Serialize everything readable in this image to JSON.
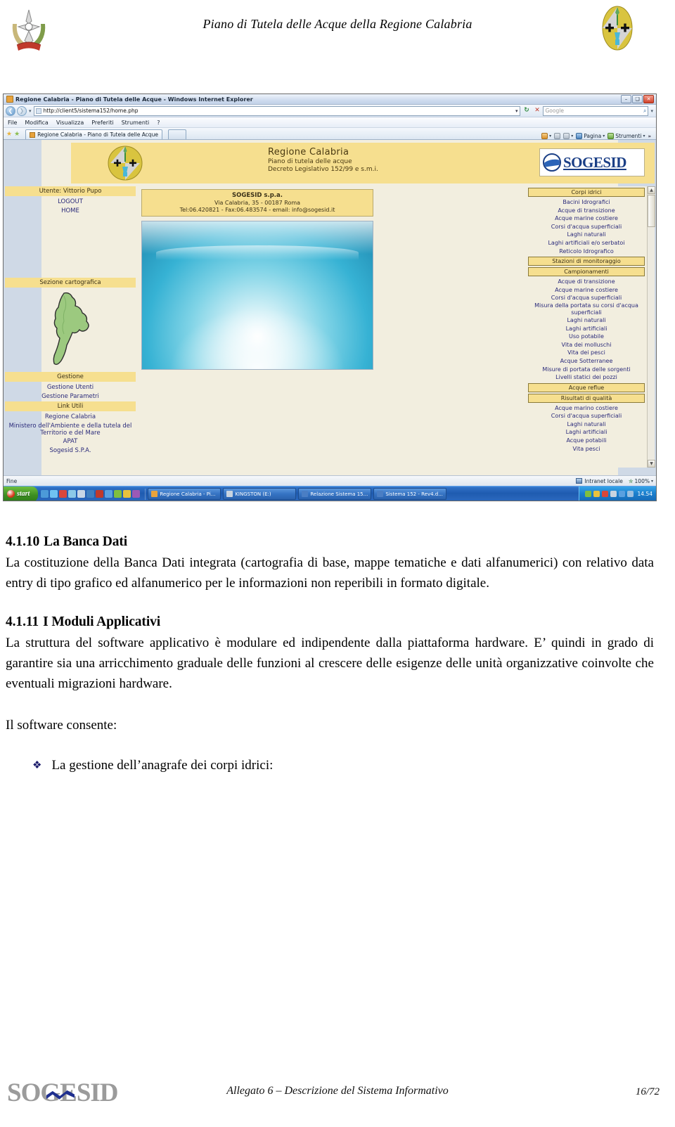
{
  "header": {
    "title": "Piano di Tutela delle Acque della Regione Calabria",
    "crest_left_name": "emblem-of-italy",
    "crest_right_name": "regione-calabria-coat-of-arms"
  },
  "browser": {
    "window_title": "Regione Calabria - Piano di Tutela delle Acque - Windows Internet Explorer",
    "window_buttons": {
      "minimize": "–",
      "maximize": "❑",
      "close": "✕"
    },
    "address": {
      "url": "http://client5/sistema152/home.php",
      "dropdown": "▾",
      "refresh": "↻",
      "stop": "✕"
    },
    "search": {
      "placeholder": "Google",
      "go": "⌕"
    },
    "menu": [
      "File",
      "Modifica",
      "Visualizza",
      "Preferiti",
      "Strumenti",
      "?"
    ],
    "tab": {
      "label": "Regione Calabria - Piano di Tutela delle Acque"
    },
    "commands": [
      {
        "label": "",
        "caret": "▾",
        "name": "home-command"
      },
      {
        "label": "",
        "caret": "",
        "name": "feeds-command"
      },
      {
        "label": "",
        "caret": "▾",
        "name": "print-command"
      },
      {
        "label": "Pagina",
        "caret": "▾",
        "name": "page-command"
      },
      {
        "label": "Strumenti",
        "caret": "▾",
        "name": "tools-command"
      }
    ],
    "commands_more": "»",
    "statusbar": {
      "status": "Fine",
      "zone": "Intranet locale",
      "zoom": "100%",
      "zoom_caret": "▾"
    }
  },
  "webpage": {
    "banner": {
      "line1": "Regione Calabria",
      "line2": "Piano di tutela delle acque",
      "line3": "Decreto Legislativo 152/99 e s.m.i.",
      "logo_text": "SOGESID"
    },
    "user_panel": {
      "user_label": "Utente: Vittorio Pupo",
      "links": [
        "LOGOUT",
        "HOME"
      ]
    },
    "left_sections": [
      {
        "header": "Sezione cartografica",
        "links": []
      },
      {
        "header": "Gestione",
        "links": [
          "Gestione Utenti",
          "Gestione Parametri"
        ]
      },
      {
        "header": "Link Utili",
        "links": [
          "Regione Calabria",
          "Ministero dell'Ambiente e della tutela del Territorio e del Mare",
          "APAT",
          "Sogesid S.P.A."
        ]
      }
    ],
    "contact_box": {
      "name": "SOGESID s.p.a.",
      "address": "Via Calabria, 35 - 00187 Roma",
      "contacts": "Tel:06.420821 - Fax:06.483574 - email: info@sogesid.it"
    },
    "image_caption": "waterfall-photo",
    "menu_panel": [
      {
        "type": "header",
        "label": "Corpi idrici"
      },
      {
        "type": "link",
        "label": "Bacini Idrografici"
      },
      {
        "type": "link",
        "label": "Acque di transizione"
      },
      {
        "type": "link",
        "label": "Acque marine costiere"
      },
      {
        "type": "link",
        "label": "Corsi d'acqua superficiali"
      },
      {
        "type": "link",
        "label": "Laghi naturali"
      },
      {
        "type": "link",
        "label": "Laghi artificiali e/o serbatoi"
      },
      {
        "type": "link",
        "label": "Reticolo Idrografico"
      },
      {
        "type": "header",
        "label": "Stazioni di monitoraggio"
      },
      {
        "type": "header",
        "label": "Campionamenti"
      },
      {
        "type": "link",
        "label": "Acque di transizione"
      },
      {
        "type": "link",
        "label": "Acque marine costiere"
      },
      {
        "type": "link",
        "label": "Corsi d'acqua superficiali"
      },
      {
        "type": "link2",
        "label": "Misura della portata su corsi d'acqua superficiali"
      },
      {
        "type": "link",
        "label": "Laghi naturali"
      },
      {
        "type": "link",
        "label": "Laghi artificiali"
      },
      {
        "type": "link",
        "label": "Uso potabile"
      },
      {
        "type": "link",
        "label": "Vita dei molluschi"
      },
      {
        "type": "link",
        "label": "Vita dei pesci"
      },
      {
        "type": "link",
        "label": "Acque Sotterranee"
      },
      {
        "type": "link",
        "label": "Misure di portata delle sorgenti"
      },
      {
        "type": "link",
        "label": "Livelli statici dei pozzi"
      },
      {
        "type": "header",
        "label": "Acque reflue"
      },
      {
        "type": "header",
        "label": "Risultati di qualità"
      },
      {
        "type": "link",
        "label": "Acque marino costiere"
      },
      {
        "type": "link",
        "label": "Corsi d'acqua superficiali"
      },
      {
        "type": "link",
        "label": "Laghi naturali"
      },
      {
        "type": "link",
        "label": "Laghi artificiali"
      },
      {
        "type": "link",
        "label": "Acque potabili"
      },
      {
        "type": "link",
        "label": "Vita pesci"
      }
    ]
  },
  "taskbar": {
    "start_label": "start",
    "buttons": [
      {
        "label": "Regione Calabria - Pi...",
        "active": true
      },
      {
        "label": "KINGSTON (E:)",
        "active": false
      },
      {
        "label": "Relazione Sistema 15...",
        "active": false
      },
      {
        "label": "Sistema 152 - Rev4.d...",
        "active": false
      }
    ],
    "clock": "14.54"
  },
  "document": {
    "section1": {
      "number": "4.1.10",
      "title": "La Banca Dati",
      "paragraph": "La costituzione della Banca Dati integrata (cartografia di base, mappe tematiche e dati alfanumerici) con relativo data entry di tipo grafico ed alfanumerico per le informazioni non reperibili in formato digitale."
    },
    "section2": {
      "number": "4.1.11",
      "title": "I Moduli Applicativi",
      "paragraph": "La struttura del software applicativo è modulare ed indipendente dalla piattaforma hardware. E’ quindi in grado di garantire sia una arricchimento graduale delle funzioni al crescere delle esigenze delle unità organizzative coinvolte che eventuali migrazioni hardware."
    },
    "lead_in": "Il software consente:",
    "bullet": {
      "mark": "❖",
      "text": "La gestione dell’anagrafe dei corpi idrici:"
    }
  },
  "footer": {
    "logo_text": "SOGESID",
    "center_text": "Allegato 6 – Descrizione del Sistema Informativo",
    "page_number": "16/72"
  }
}
